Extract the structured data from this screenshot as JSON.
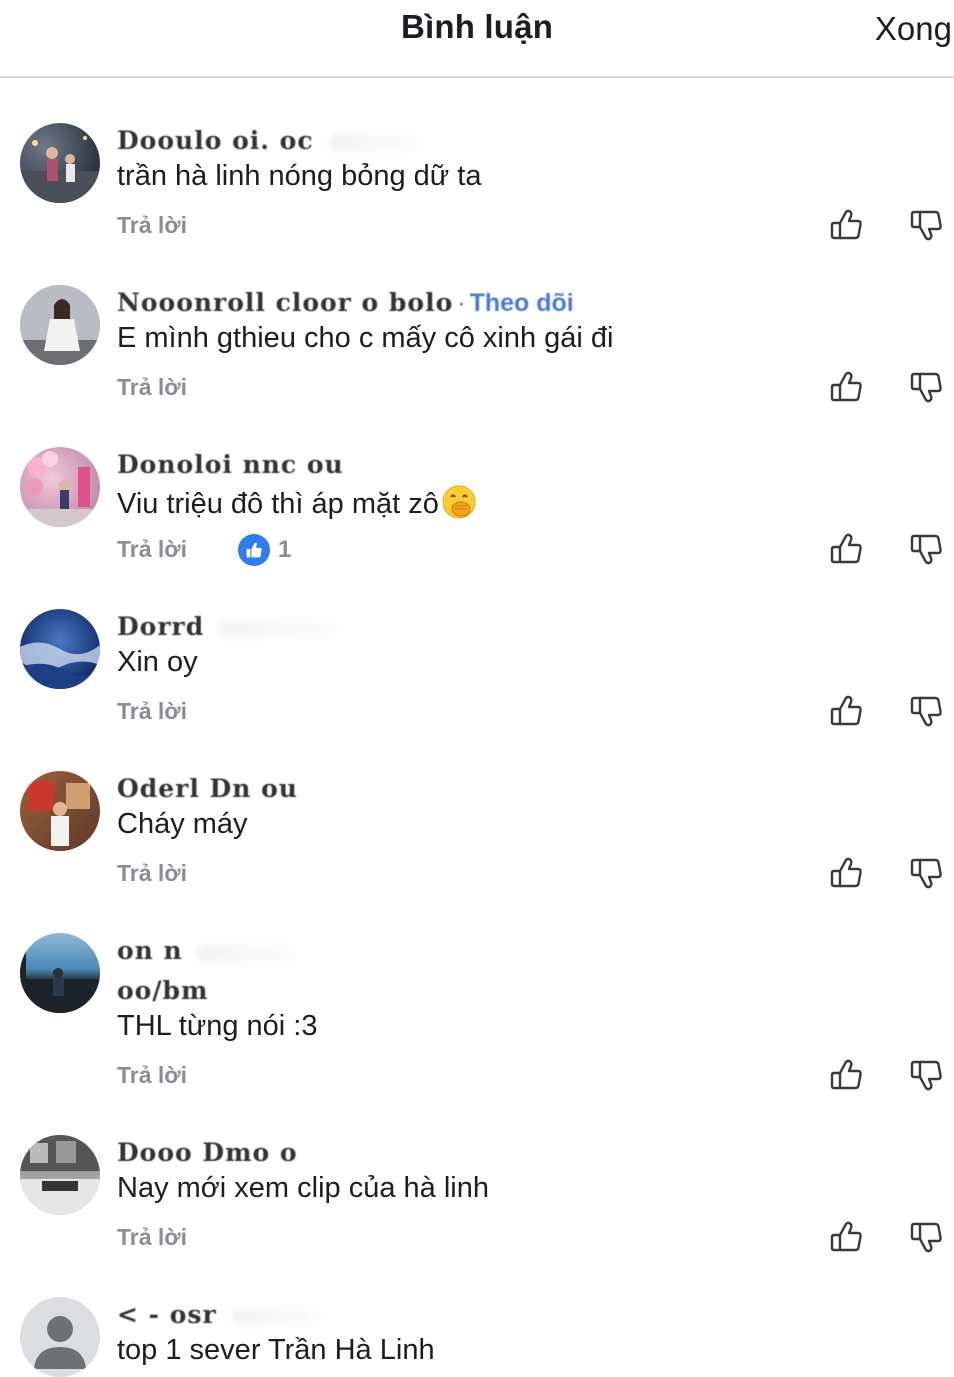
{
  "header": {
    "title": "Bình luận",
    "done_label": "Xong"
  },
  "comments": [
    {
      "author": "Dooulo oi. oc",
      "text": "trần hà linh nóng bỏng dữ ta",
      "reply_label": "Trả lời"
    },
    {
      "author": "Nooonroll cloor o bolo",
      "follow_label": "Theo dõi",
      "text": "E mình gthieu cho c mấy cô xinh gái đi",
      "reply_label": "Trả lời"
    },
    {
      "author": "Donoloi nnc ou",
      "text": "Viu triệu đô thì áp mặt zô",
      "emoji": "face-with-hand-over-mouth",
      "reply_label": "Trả lời",
      "like_count": "1"
    },
    {
      "author": "Dorrd",
      "text": "Xin oy",
      "reply_label": "Trả lời"
    },
    {
      "author": "Oderl Dn ou",
      "text": "Cháy máy",
      "reply_label": "Trả lời"
    },
    {
      "author": "on n",
      "author_line2": "oo/bm",
      "text": "THL từng nói :3",
      "reply_label": "Trả lời"
    },
    {
      "author": "Dooo Dmo o",
      "text": "Nay mới xem clip của hà linh",
      "reply_label": "Trả lời"
    },
    {
      "author": "< - osr",
      "text": "top 1 sever Trần Hà Linh"
    }
  ],
  "icons": {
    "like": "thumbs-up-icon",
    "dislike": "thumbs-down-icon"
  },
  "colors": {
    "accent": "#3a6fd8",
    "like_badge": "#2d7cf0",
    "muted": "#8a8d91"
  }
}
